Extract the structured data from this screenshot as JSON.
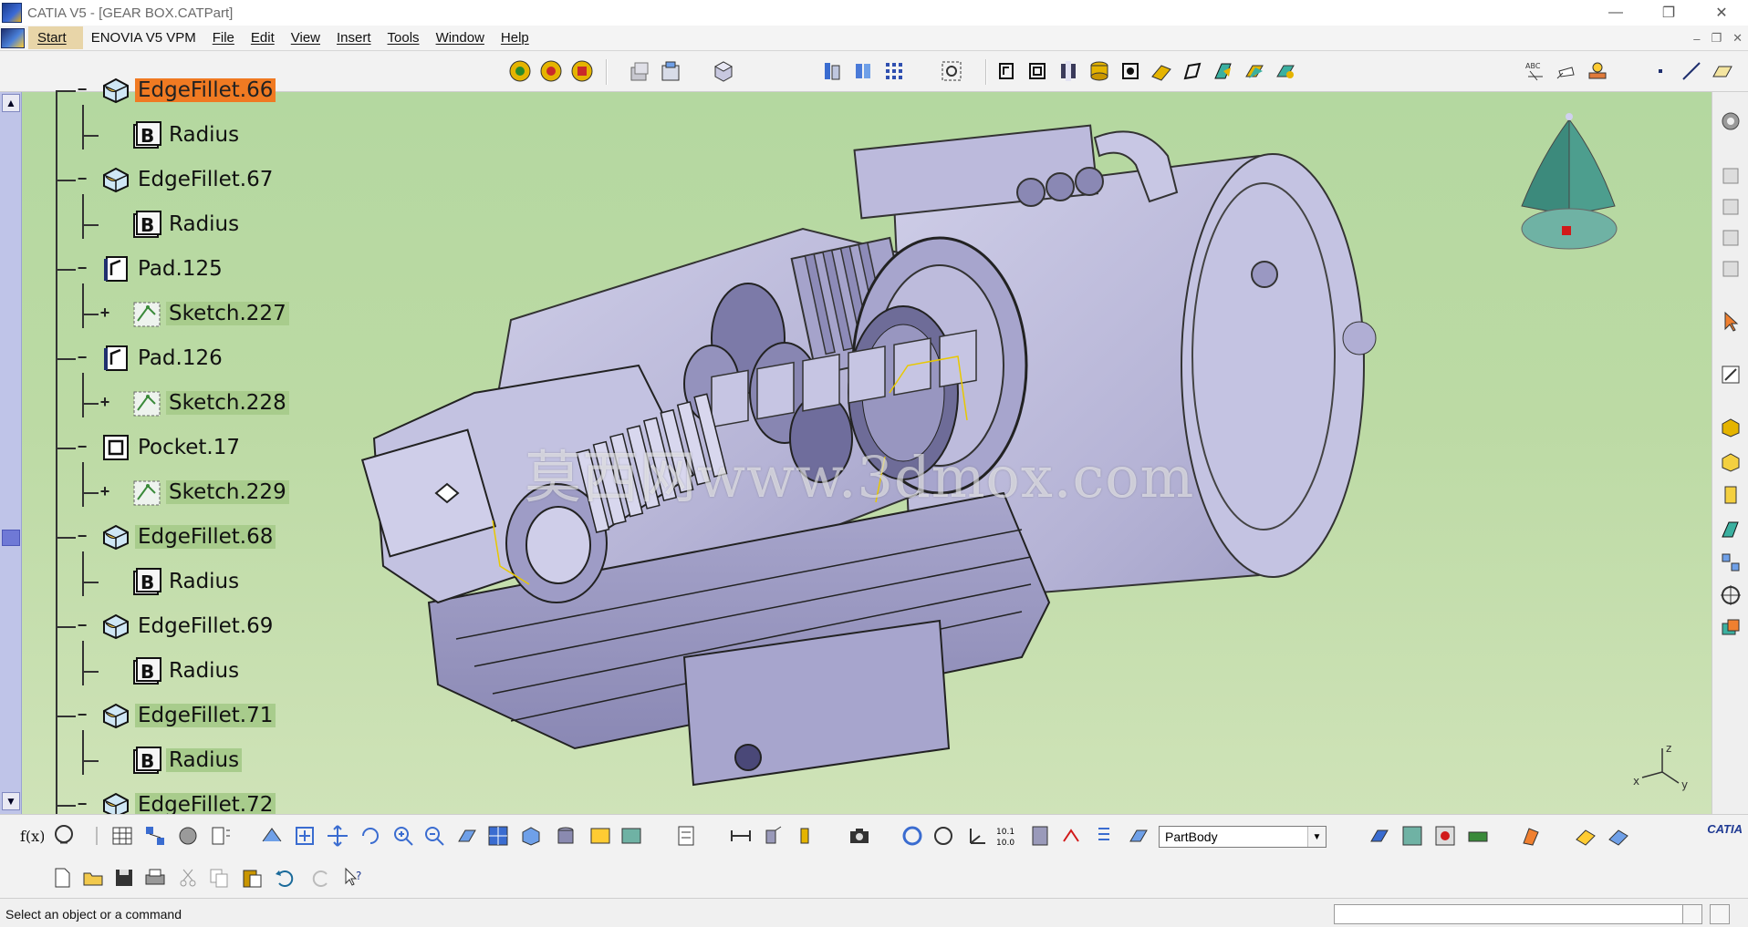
{
  "window": {
    "title": "CATIA V5 - [GEAR BOX.CATPart]",
    "controls": [
      "—",
      "❐",
      "✕"
    ]
  },
  "menubar": {
    "items": [
      {
        "label": "Start",
        "underline": true
      },
      {
        "label": "ENOVIA V5 VPM",
        "underline": false
      },
      {
        "label": "File",
        "underline": true
      },
      {
        "label": "Edit",
        "underline": true
      },
      {
        "label": "View",
        "underline": true
      },
      {
        "label": "Insert",
        "underline": true
      },
      {
        "label": "Tools",
        "underline": true
      },
      {
        "label": "Window",
        "underline": true
      },
      {
        "label": "Help",
        "underline": true
      }
    ],
    "doc_controls": [
      "–",
      "❐",
      "✕"
    ]
  },
  "tree": {
    "nodes": [
      {
        "label": "EdgeFillet.66",
        "type": "edgefillet",
        "level": 0,
        "state": "selected-orange"
      },
      {
        "label": "Radius",
        "type": "parameter",
        "level": 1,
        "state": "normal"
      },
      {
        "label": "EdgeFillet.67",
        "type": "edgefillet",
        "level": 0,
        "state": "normal"
      },
      {
        "label": "Radius",
        "type": "parameter",
        "level": 1,
        "state": "normal"
      },
      {
        "label": "Pad.125",
        "type": "pad",
        "level": 0,
        "state": "normal"
      },
      {
        "label": "Sketch.227",
        "type": "sketch",
        "level": 1,
        "state": "highlight"
      },
      {
        "label": "Pad.126",
        "type": "pad",
        "level": 0,
        "state": "normal"
      },
      {
        "label": "Sketch.228",
        "type": "sketch",
        "level": 1,
        "state": "highlight"
      },
      {
        "label": "Pocket.17",
        "type": "pocket",
        "level": 0,
        "state": "normal"
      },
      {
        "label": "Sketch.229",
        "type": "sketch",
        "level": 1,
        "state": "highlight"
      },
      {
        "label": "EdgeFillet.68",
        "type": "edgefillet",
        "level": 0,
        "state": "highlight"
      },
      {
        "label": "Radius",
        "type": "parameter",
        "level": 1,
        "state": "normal"
      },
      {
        "label": "EdgeFillet.69",
        "type": "edgefillet",
        "level": 0,
        "state": "normal"
      },
      {
        "label": "Radius",
        "type": "parameter",
        "level": 1,
        "state": "normal"
      },
      {
        "label": "EdgeFillet.71",
        "type": "edgefillet",
        "level": 0,
        "state": "highlight"
      },
      {
        "label": "Radius",
        "type": "parameter",
        "level": 1,
        "state": "highlight"
      },
      {
        "label": "EdgeFillet.72",
        "type": "edgefillet",
        "level": 0,
        "state": "highlight"
      }
    ]
  },
  "viewport": {
    "watermark": "莫西网www.3dmox.com",
    "background_top": "#b4d8a0",
    "background_bottom": "#cfe3b8",
    "model_color": "#b9b8d8",
    "axis": {
      "x": "x",
      "y": "y",
      "z": "z"
    }
  },
  "bottom": {
    "current_body": "PartBody",
    "brand": "CATIA"
  },
  "status": {
    "message": "Select an object or a command"
  },
  "colors": {
    "accent_orange": "#f07a22",
    "tree_highlight": "#a8cc8c",
    "scroll_thumb": "#6f79d6"
  }
}
